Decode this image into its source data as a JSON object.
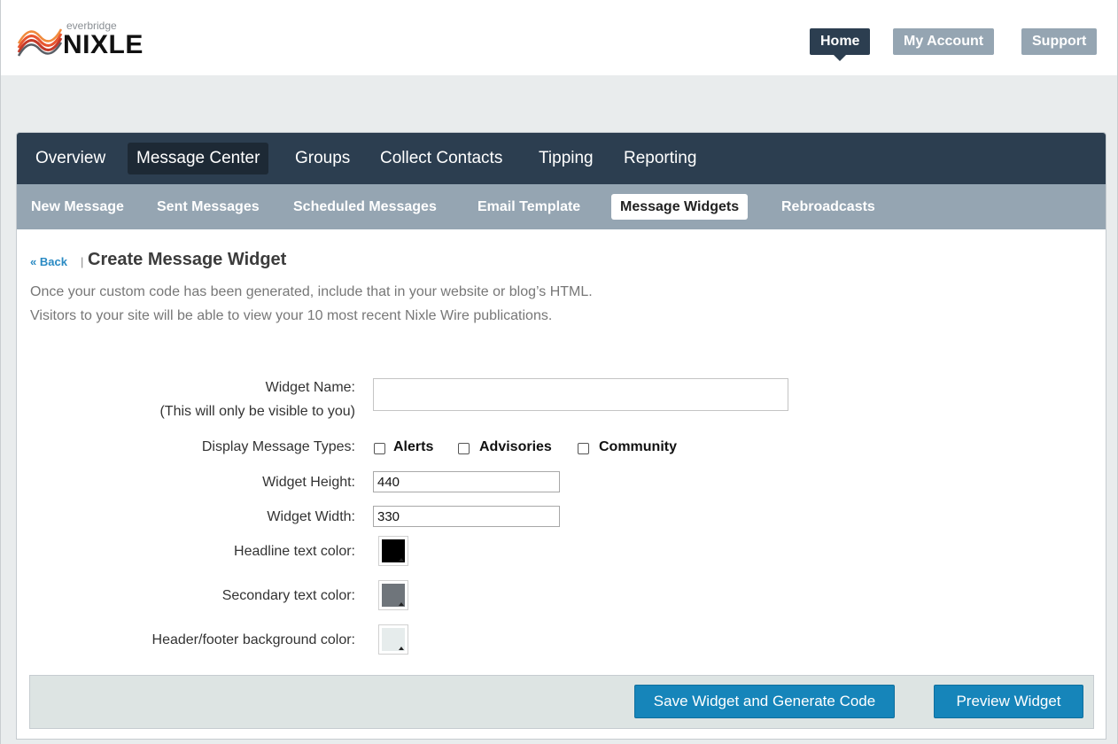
{
  "logo": {
    "small": "everbridge",
    "big": "NIXLE"
  },
  "top_nav": {
    "home": "Home",
    "account": "My Account",
    "support": "Support"
  },
  "main_nav": [
    "Overview",
    "Message Center",
    "Groups",
    "Collect Contacts",
    "Tipping",
    "Reporting"
  ],
  "main_nav_active": "Message Center",
  "sub_nav": [
    "New Message",
    "Sent Messages",
    "Scheduled Messages",
    "Email Template",
    "Message Widgets",
    "Rebroadcasts"
  ],
  "sub_nav_active": "Message Widgets",
  "page": {
    "back": "« Back",
    "separator": "|",
    "title": "Create Message Widget",
    "desc1": "Once your custom code has been generated, include that in your website or blog’s HTML.",
    "desc2": "Visitors to your site will be able to view your 10 most recent Nixle Wire publications."
  },
  "form": {
    "widget_name_label": "Widget Name:",
    "widget_name_hint": "(This will only be visible to you)",
    "widget_name_value": "",
    "types_label": "Display Message Types:",
    "types": [
      "Alerts",
      "Advisories",
      "Community"
    ],
    "height_label": "Widget Height:",
    "height_value": "440",
    "width_label": "Widget Width:",
    "width_value": "330",
    "headline_label": "Headline text color:",
    "headline_color": "#000000",
    "secondary_label": "Secondary text color:",
    "secondary_color": "#6f757b",
    "hf_label": "Header/footer background color:",
    "hf_color": "#e6ecec"
  },
  "buttons": {
    "save": "Save Widget and Generate Code",
    "preview": "Preview Widget"
  },
  "colors": {
    "dark_nav": "#2c3e50",
    "sub_nav": "#95a5b2",
    "accent": "#1685ba",
    "link": "#2a8ac3"
  }
}
